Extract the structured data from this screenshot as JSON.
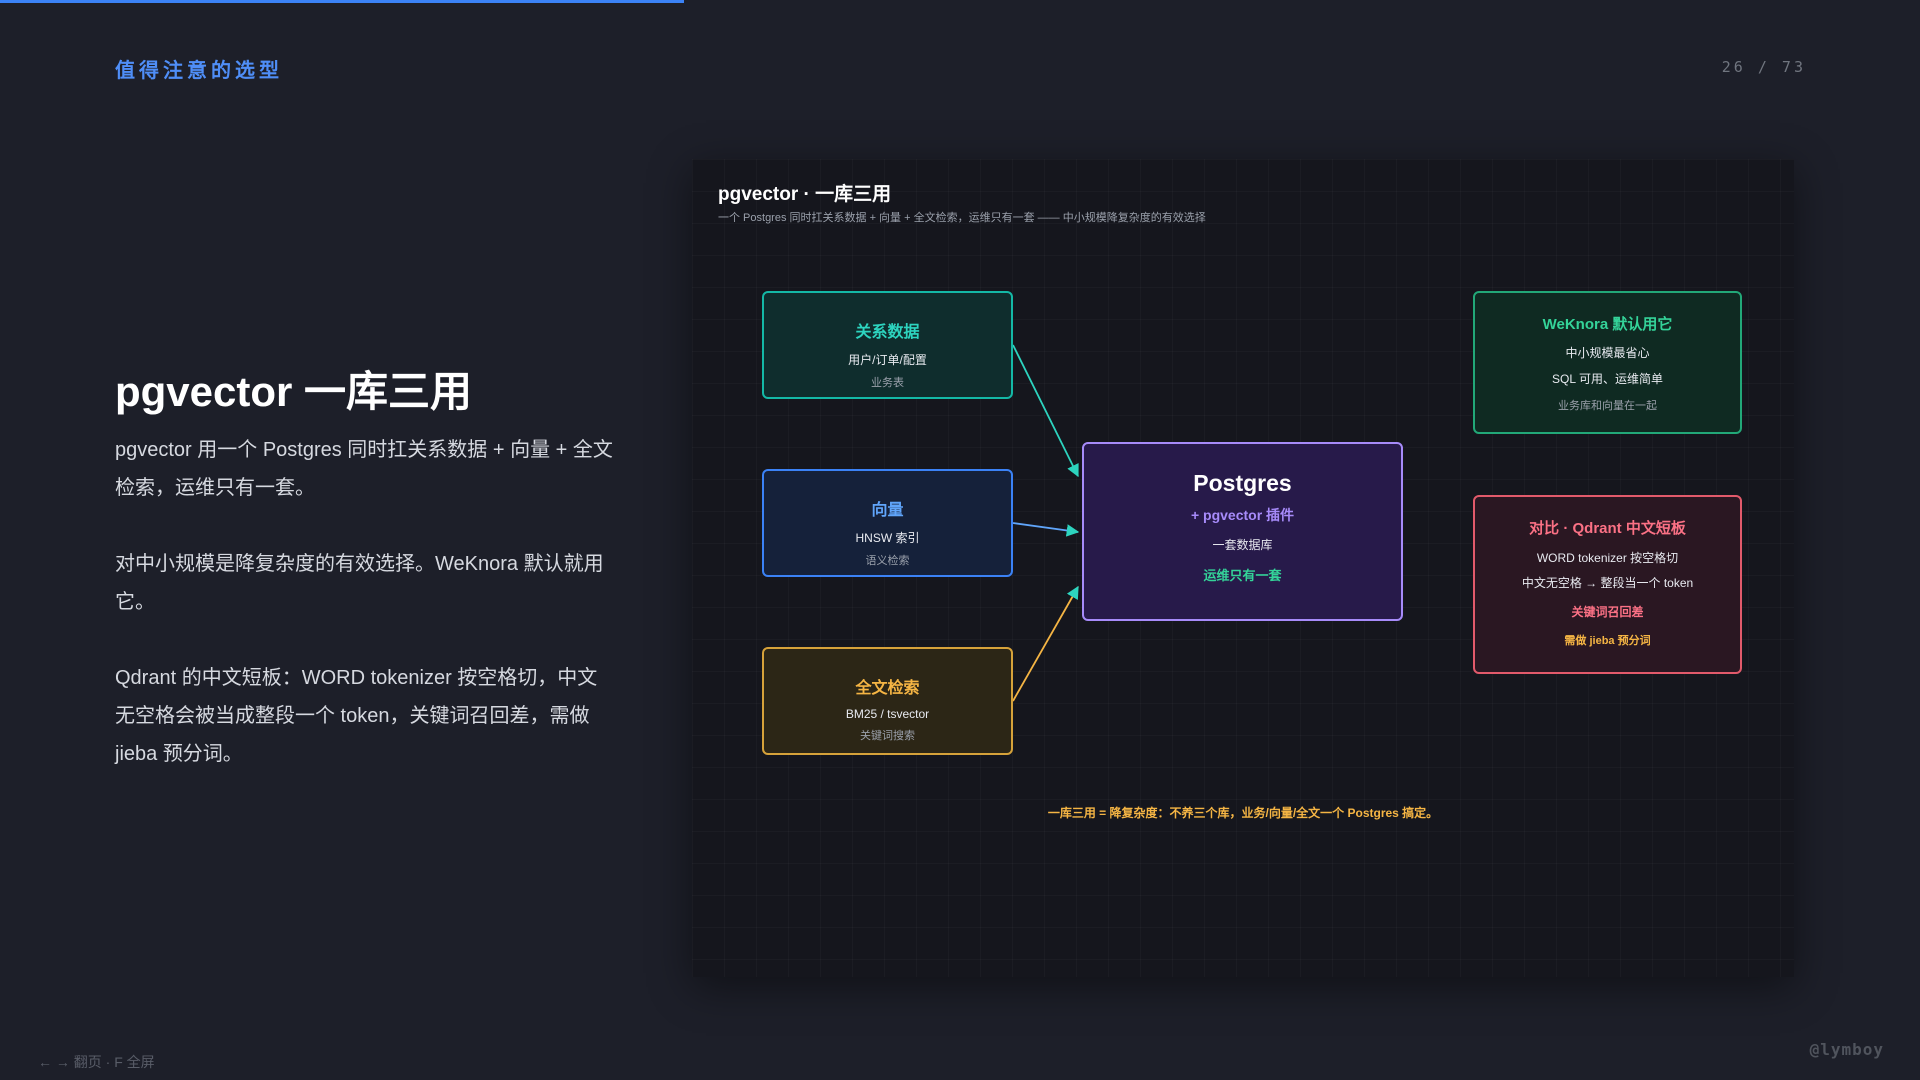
{
  "section_label": "值得注意的选型",
  "page_counter": "26 / 73",
  "title": "pgvector 一库三用",
  "paragraphs": [
    "pgvector 用一个 Postgres 同时扛关系数据 + 向量 + 全文检索，运维只有一套。",
    "对中小规模是降复杂度的有效选择。WeKnora 默认就用它。",
    "Qdrant 的中文短板：WORD tokenizer 按空格切，中文无空格会被当成整段一个 token，关键词召回差，需做 jieba 预分词。"
  ],
  "diagram": {
    "title": "pgvector · 一库三用",
    "subtitle": "一个 Postgres 同时扛关系数据 + 向量 + 全文检索，运维只有一套 —— 中小规模降复杂度的有效选择",
    "relational": {
      "title": "关系数据",
      "line": "用户/订单/配置",
      "sub": "业务表"
    },
    "vector": {
      "title": "向量",
      "line": "HNSW 索引",
      "sub": "语义检索"
    },
    "fulltext": {
      "title": "全文检索",
      "line": "BM25 / tsvector",
      "sub": "关键词搜索"
    },
    "postgres": {
      "title": "Postgres",
      "plugin": "+ pgvector 插件",
      "line": "一套数据库",
      "ops": "运维只有一套"
    },
    "weknora": {
      "title": "WeKnora 默认用它",
      "line1": "中小规模最省心",
      "line2": "SQL 可用、运维简单",
      "sub": "业务库和向量在一起"
    },
    "qdrant": {
      "title": "对比 · Qdrant 中文短板",
      "line1": "WORD tokenizer 按空格切",
      "line2": "中文无空格 → 整段当一个 token",
      "warn1": "关键词召回差",
      "warn2": "需做 jieba 预分词"
    },
    "footnote": "一库三用 = 降复杂度：不养三个库，业务/向量/全文一个 Postgres 搞定。"
  },
  "nav_hint": "← → 翻页 · F 全屏",
  "watermark": "@lymboy",
  "colors": {
    "accent": "#3b82f6",
    "teal": "#2dd4bf",
    "blue": "#60a5fa",
    "amber": "#f5b544",
    "purple": "#a78bfa",
    "green": "#34d399",
    "red": "#fb7185"
  }
}
